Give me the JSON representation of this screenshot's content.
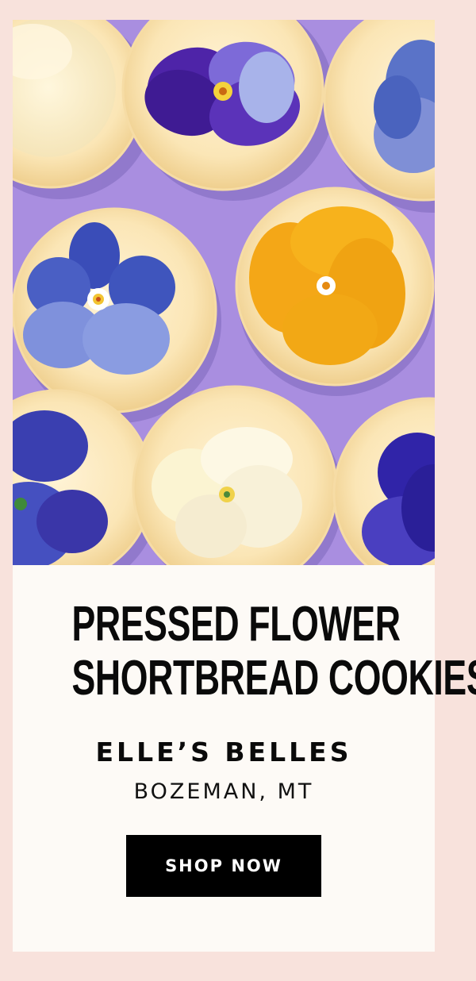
{
  "feature": {
    "title_line1": "PRESSED FLOWER",
    "title_line2": "SHORTBREAD COOKIES",
    "brand": "ELLE’S BELLES",
    "location": "BOZEMAN, MT",
    "cta_label": "SHOP NOW"
  },
  "colors": {
    "page_background": "#f8e2dc",
    "card_background": "#fdfaf6",
    "photo_background": "#a98ee0",
    "button": "#000000"
  }
}
